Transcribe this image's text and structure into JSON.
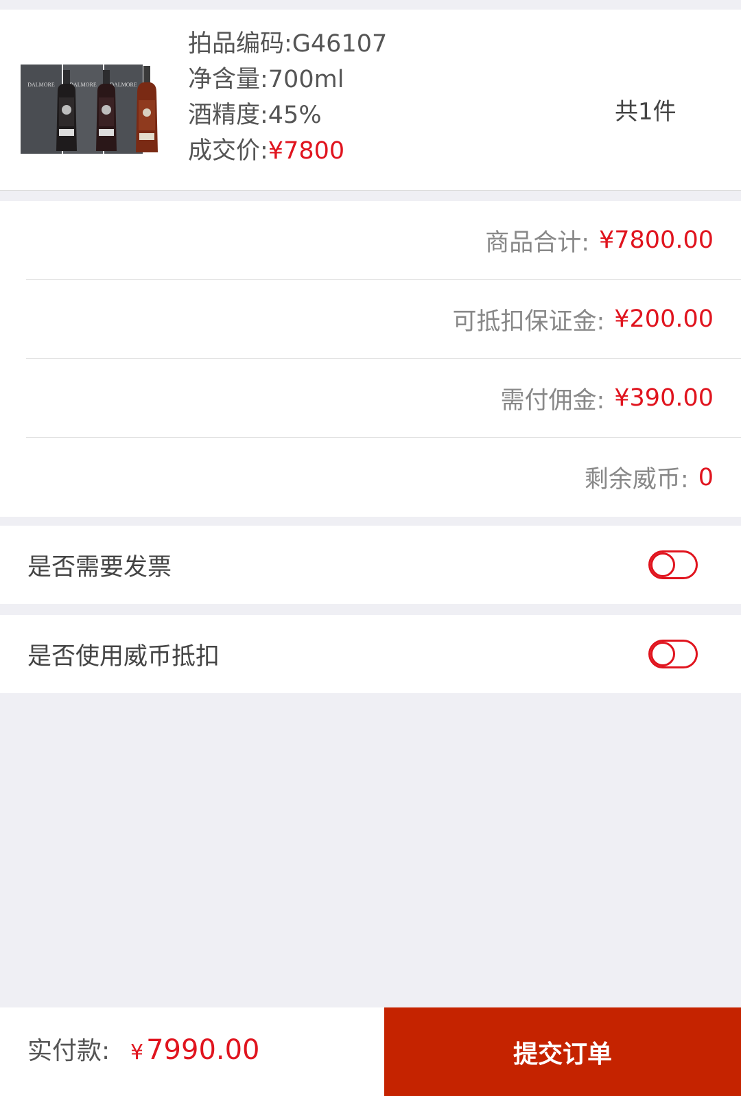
{
  "product": {
    "lot_code": "拍品编码:G46107",
    "volume": "净含量:700ml",
    "abv": "酒精度:45%",
    "price_label": "成交价:",
    "price_value": "¥7800",
    "quantity": "共1件",
    "image_icon": "whisky-bottles-image",
    "brand_text": "DALMORE"
  },
  "summary": {
    "rows": [
      {
        "label": "商品合计:",
        "value": "¥7800.00"
      },
      {
        "label": "可抵扣保证金:",
        "value": "¥200.00"
      },
      {
        "label": "需付佣金:",
        "value": "¥390.00"
      },
      {
        "label": "剩余威币:",
        "value": "0"
      }
    ]
  },
  "options": {
    "invoice_label": "是否需要发票",
    "coin_label": "是否使用威币抵扣",
    "invoice_enabled": false,
    "coin_enabled": false
  },
  "footer": {
    "pay_label": "实付款:",
    "pay_currency": "¥",
    "pay_amount": "7990.00",
    "submit_label": "提交订单"
  },
  "colors": {
    "accent_red": "#e0141e",
    "submit_bg": "#c52300",
    "page_bg": "#efeff4"
  }
}
